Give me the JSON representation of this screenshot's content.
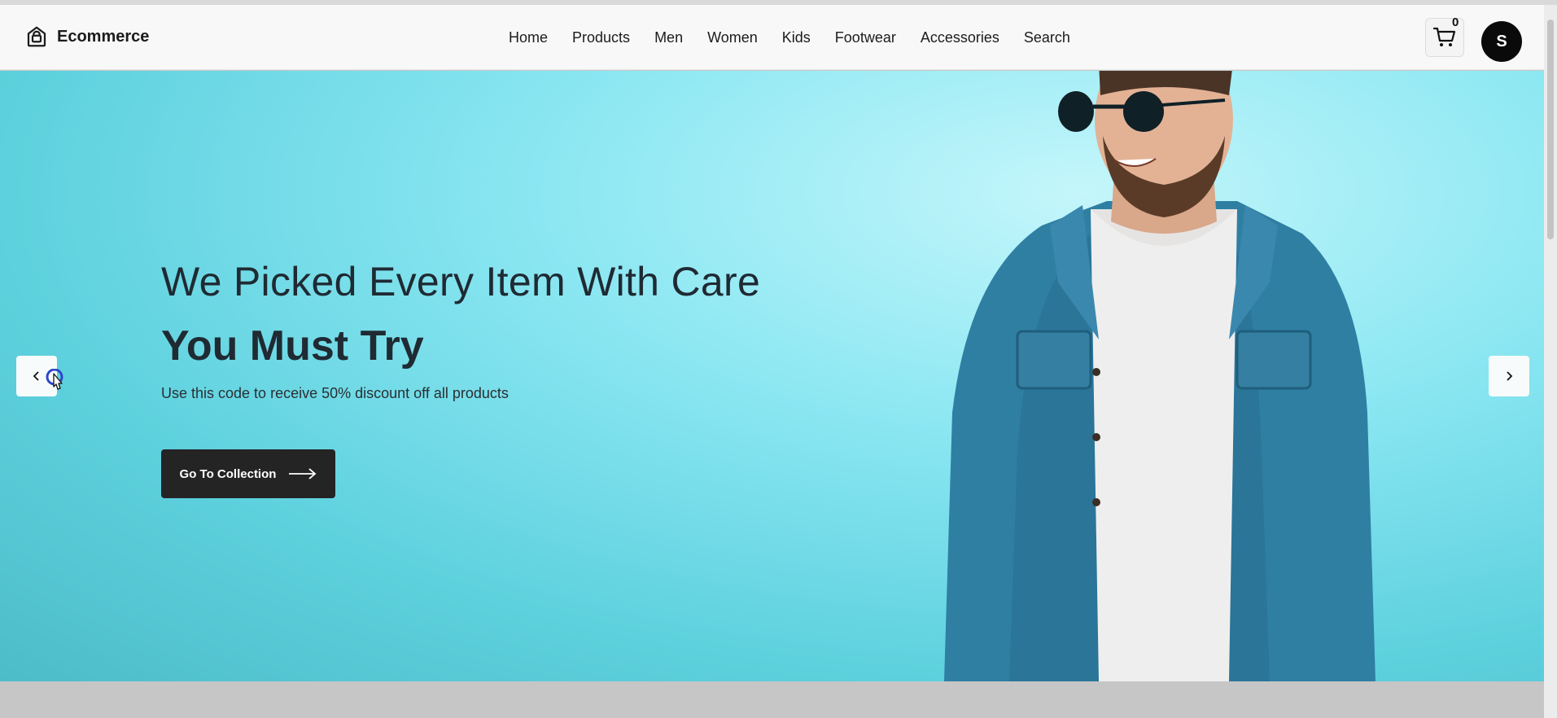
{
  "brand": {
    "name": "Ecommerce",
    "icon": "shopping-bag-icon"
  },
  "nav": {
    "items": [
      "Home",
      "Products",
      "Men",
      "Women",
      "Kids",
      "Footwear",
      "Accessories",
      "Search"
    ]
  },
  "cart": {
    "count": "0",
    "icon": "cart-icon"
  },
  "user": {
    "initial": "S"
  },
  "hero": {
    "headline": "We Picked Every Item With Care",
    "subheadline": "You Must Try",
    "description": "Use this code to receive 50% discount off all products",
    "cta_label": "Go To Collection",
    "background_color": "#8be7f2"
  },
  "slider": {
    "prev_icon": "chevron-left-icon",
    "next_icon": "chevron-right-icon"
  }
}
